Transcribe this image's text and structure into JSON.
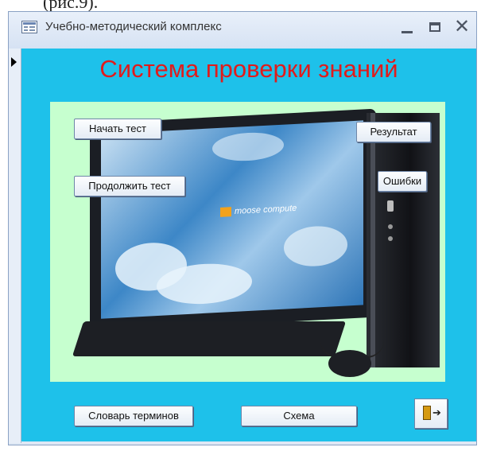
{
  "page_fragment": "(рис.9).",
  "window": {
    "title": "Учебно-методический комплекс",
    "icon": "form-icon",
    "controls": [
      "minimize-icon",
      "maximize-icon",
      "close-icon"
    ],
    "close_glyph": "✕"
  },
  "form": {
    "title": "Система проверки знаний",
    "title_color": "#e11b1b",
    "background_color": "#1ec1ea",
    "picture_background": "#c6ffcf",
    "screen_brand": "moose compute"
  },
  "buttons": {
    "start_test": "Начать тест",
    "continue_test": "Продолжить тест",
    "result": "Результат",
    "errors": "Ошибки",
    "glossary": "Словарь терминов",
    "scheme": "Схема",
    "exit_icon": "exit-door-icon"
  }
}
